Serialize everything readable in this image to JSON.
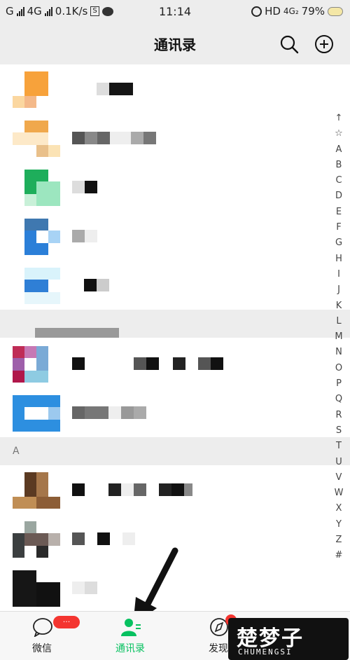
{
  "status_bar": {
    "carrier1": "G",
    "carrier2": "4G",
    "speed": "0.1K/s",
    "s_box": "S",
    "time": "11:14",
    "hd": "HD",
    "network": "4G₂",
    "battery": "79%"
  },
  "header": {
    "title": "通讯录",
    "search_icon": "search-icon",
    "add_icon": "plus-circle-icon"
  },
  "sections": {
    "a_label": "A"
  },
  "index_letters": [
    "↑",
    "☆",
    "A",
    "B",
    "C",
    "D",
    "E",
    "F",
    "G",
    "H",
    "I",
    "J",
    "K",
    "L",
    "M",
    "N",
    "O",
    "P",
    "Q",
    "R",
    "S",
    "T",
    "U",
    "V",
    "W",
    "X",
    "Y",
    "Z",
    "#"
  ],
  "tabs": [
    {
      "label": "微信",
      "icon": "chat-icon",
      "badge": "···"
    },
    {
      "label": "通讯录",
      "icon": "contacts-icon"
    },
    {
      "label": "发现",
      "icon": "compass-icon"
    }
  ],
  "watermark": {
    "main": "楚梦子",
    "sub": "CHUMENGSI"
  },
  "colors": {
    "accent": "#07c160",
    "badge": "#f43530",
    "header_bg": "#ededed"
  }
}
